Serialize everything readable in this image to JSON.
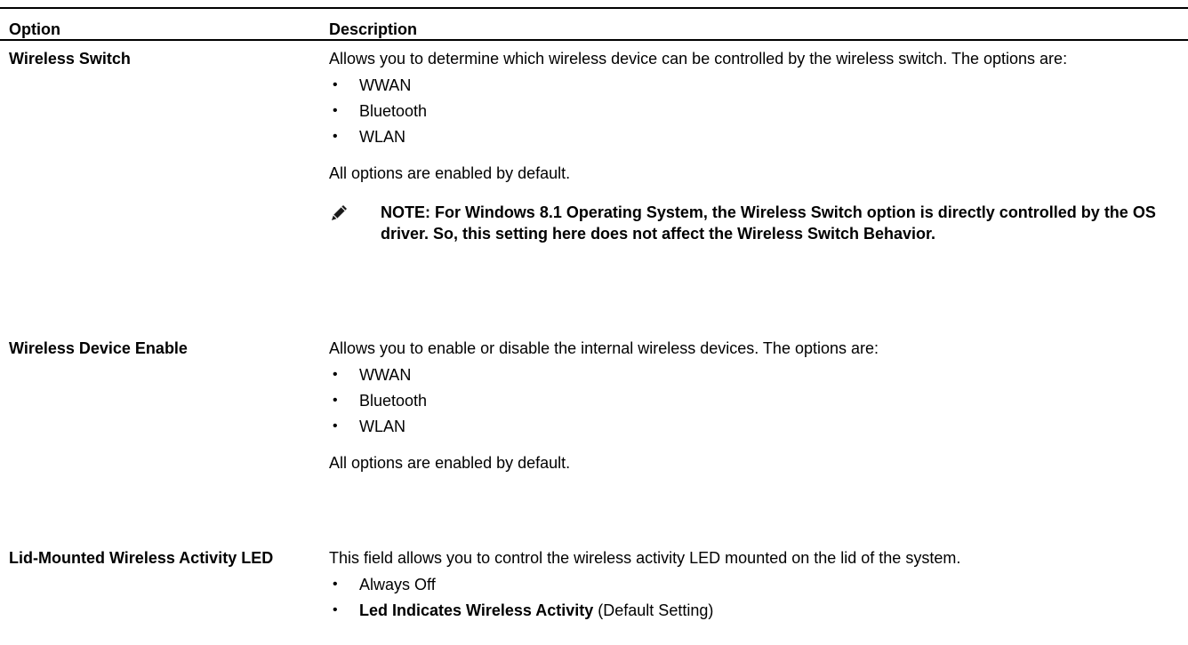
{
  "header": {
    "option": "Option",
    "description": "Description"
  },
  "rows": [
    {
      "option": "Wireless Switch",
      "description": "Allows you to determine which wireless device can be controlled by the wireless switch. The options are:",
      "items": [
        "WWAN",
        "Bluetooth",
        "WLAN"
      ],
      "default_text": "All options are enabled by default.",
      "note": "NOTE: For Windows 8.1 Operating System, the Wireless Switch option is directly controlled by the OS driver. So, this setting here does not affect the Wireless Switch Behavior."
    },
    {
      "option": "Wireless Device Enable",
      "description": "Allows you to enable or disable the internal wireless devices. The options are:",
      "items": [
        "WWAN",
        "Bluetooth",
        "WLAN"
      ],
      "default_text": "All options are enabled by default."
    },
    {
      "option": "Lid-Mounted Wireless Activity LED",
      "description": "This field allows you to control the wireless activity LED mounted on the lid of the system.",
      "items": [
        "Always Off"
      ],
      "last_item_bold": "Led Indicates Wireless Activity",
      "last_item_suffix": " (Default Setting)"
    }
  ]
}
